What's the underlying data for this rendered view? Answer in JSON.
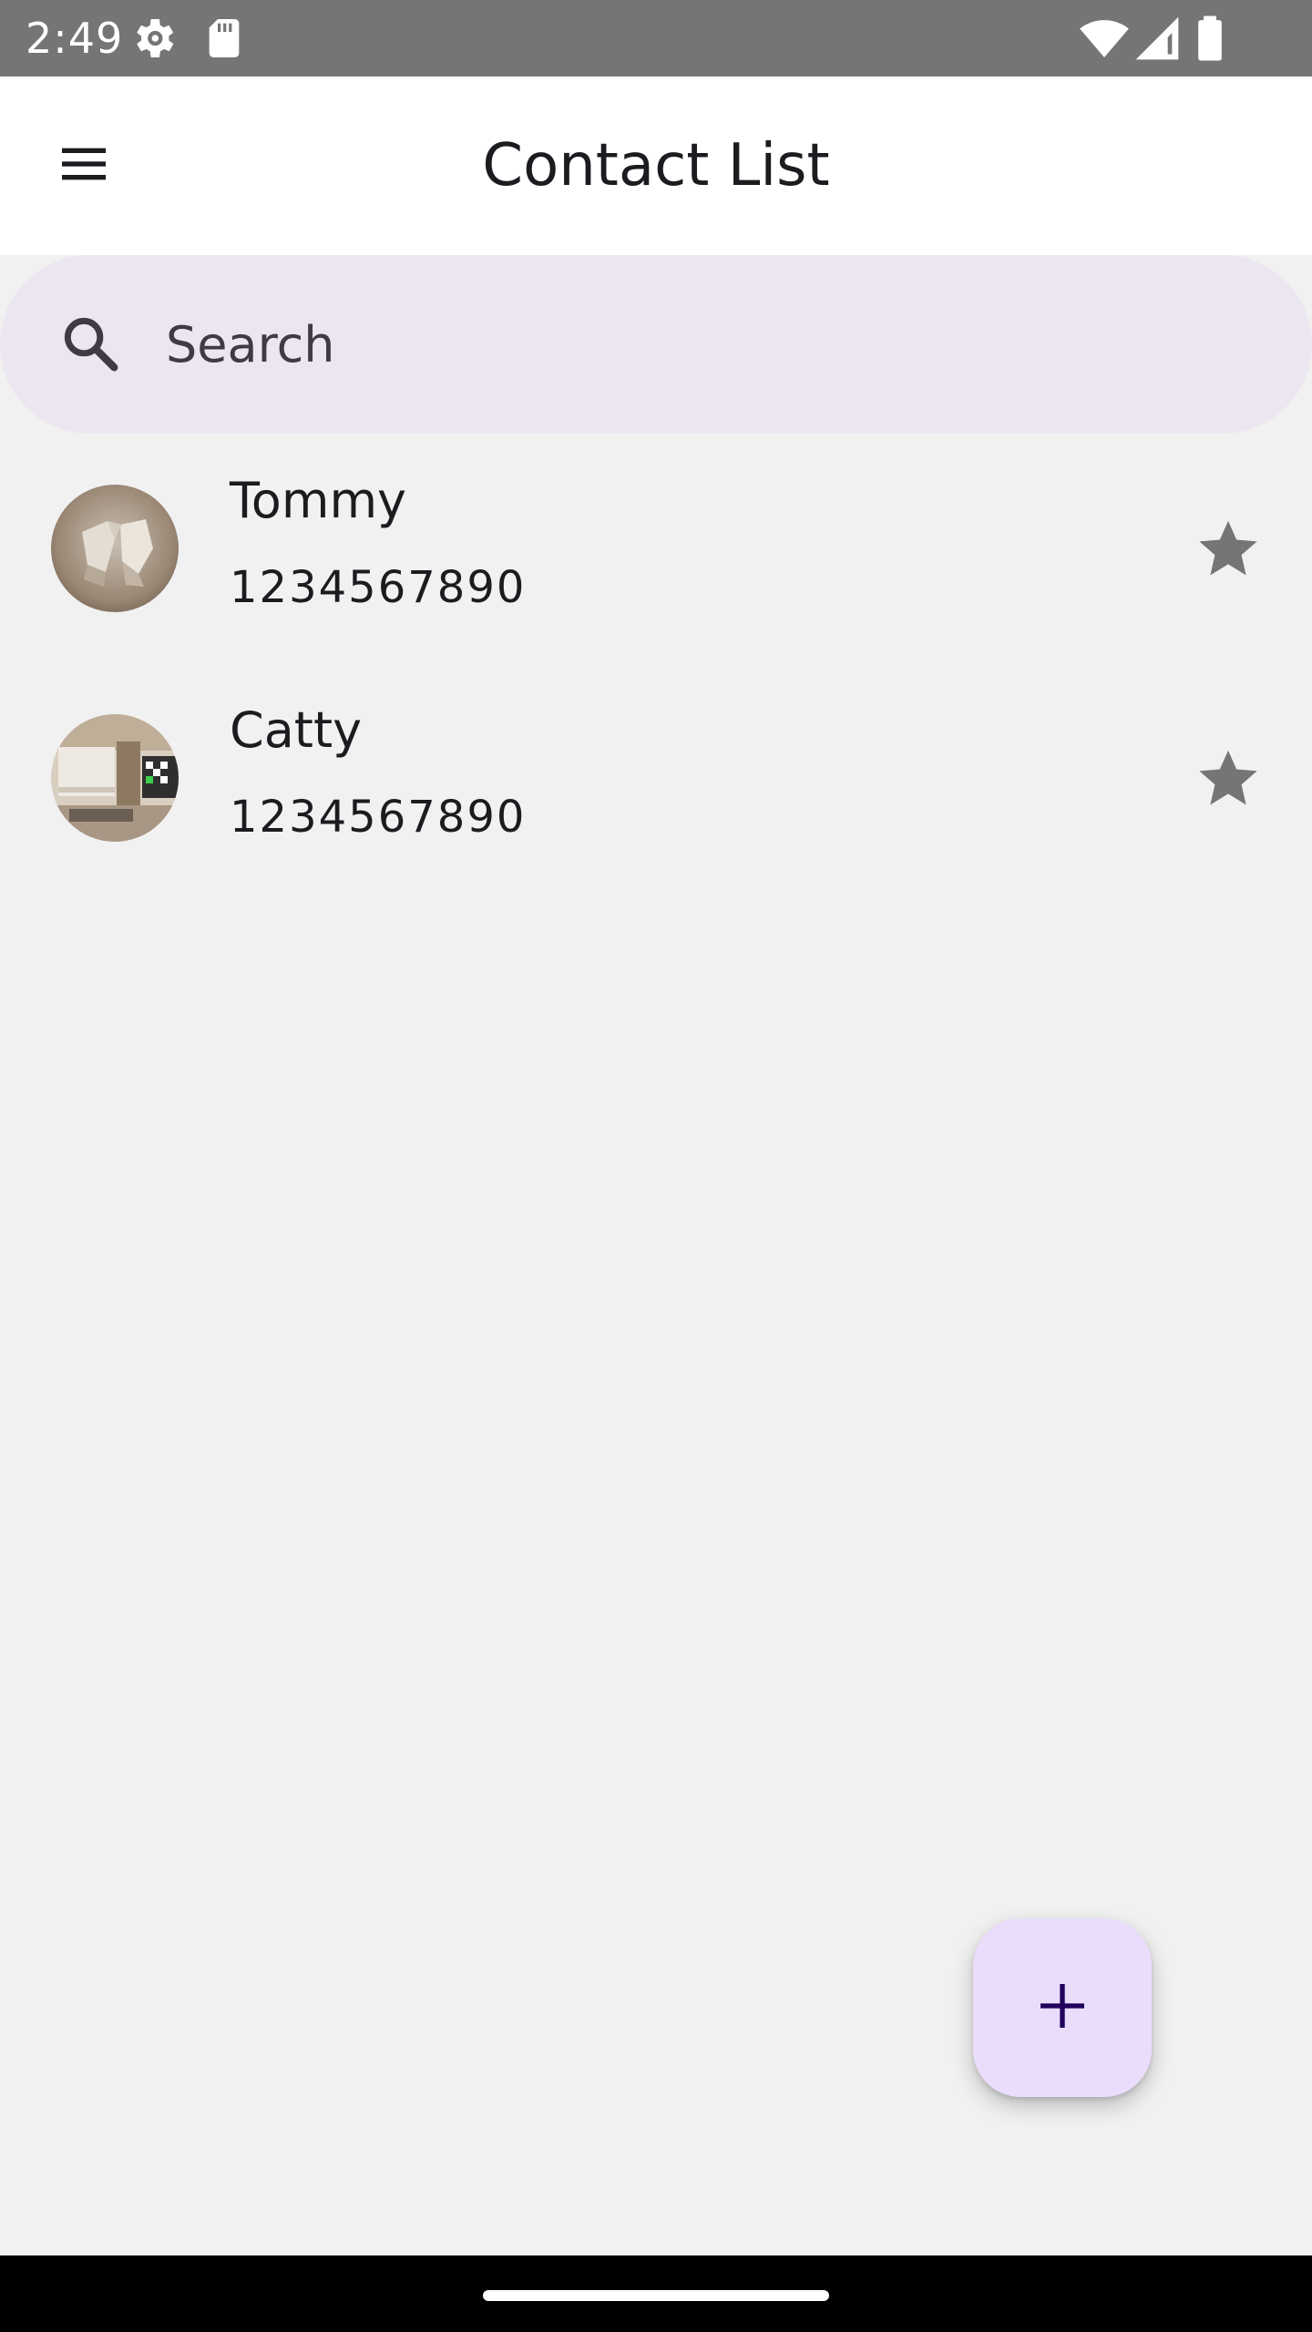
{
  "status_bar": {
    "time": "2:49",
    "icons": [
      "settings-gear-icon",
      "sd-card-icon",
      "wifi-icon",
      "cell-signal-icon",
      "battery-icon"
    ]
  },
  "app_bar": {
    "title": "Contact List",
    "menu_icon": "hamburger-menu-icon"
  },
  "search": {
    "placeholder": "Search",
    "icon": "search-icon"
  },
  "contacts": [
    {
      "name": "Tommy",
      "phone": "1234567890",
      "favorite_icon": "star-icon"
    },
    {
      "name": "Catty",
      "phone": "1234567890",
      "favorite_icon": "star-icon"
    }
  ],
  "fab": {
    "icon": "plus-icon",
    "color": "#eaddfc"
  },
  "colors": {
    "status_bar": "#757575",
    "search_bg": "#ece6f1",
    "background": "#f1f1f1",
    "star": "#757575",
    "fab_icon": "#21005d"
  }
}
